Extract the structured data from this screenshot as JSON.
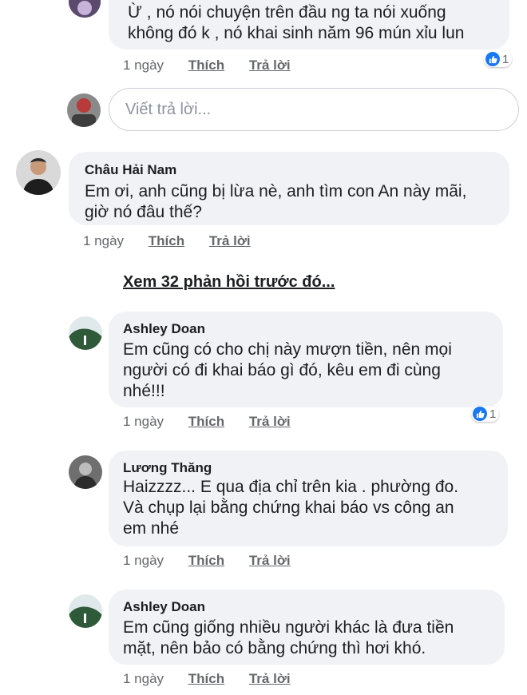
{
  "comments": [
    {
      "text_lines": [
        "Ừ , nó nói chuyện trên đầu ng ta nói xuống",
        "không đó k , nó khai sinh năm 96 mún xỉu lun"
      ],
      "time": "1 ngày",
      "like_label": "Thích",
      "reply_label": "Trả lời",
      "reaction_count": "1"
    },
    {
      "author": "Châu Hải Nam",
      "text_lines": [
        "Em ơi, anh cũng bị lừa nè, anh tìm con An này mãi,",
        "giờ nó đâu thế?"
      ],
      "time": "1 ngày",
      "like_label": "Thích",
      "reply_label": "Trả lời"
    },
    {
      "author": "Ashley Doan",
      "text_lines": [
        "Em cũng có cho chị này mượn tiền, nên mọi",
        "người có đi khai báo gì đó, kêu em đi cùng",
        "nhé!!!"
      ],
      "time": "1 ngày",
      "like_label": "Thích",
      "reply_label": "Trả lời",
      "reaction_count": "1"
    },
    {
      "author": "Lương Thăng",
      "text_lines": [
        "Haizzzz... E qua địa chỉ trên kia . phường đo.",
        "Và chụp lại bằng chứng khai báo vs công an",
        "em nhé"
      ],
      "time": "1 ngày",
      "like_label": "Thích",
      "reply_label": "Trả lời"
    },
    {
      "author": "Ashley Doan",
      "text_lines": [
        "Em cũng giống nhiều người khác là đưa tiền",
        "mặt, nên bảo có bằng chứng thì hơi khó."
      ],
      "time": "1 ngày",
      "like_label": "Thích",
      "reply_label": "Trả lời"
    }
  ],
  "reply_input": {
    "placeholder": "Viết trả lời..."
  },
  "view_more": "Xem 32 phản hồi trước đó...",
  "colors": {
    "bubble": "#f0f2f5",
    "like_blue": "#1877f2",
    "meta_gray": "#65676b"
  },
  "icons": {
    "reaction": "like-thumbs-up-icon"
  }
}
